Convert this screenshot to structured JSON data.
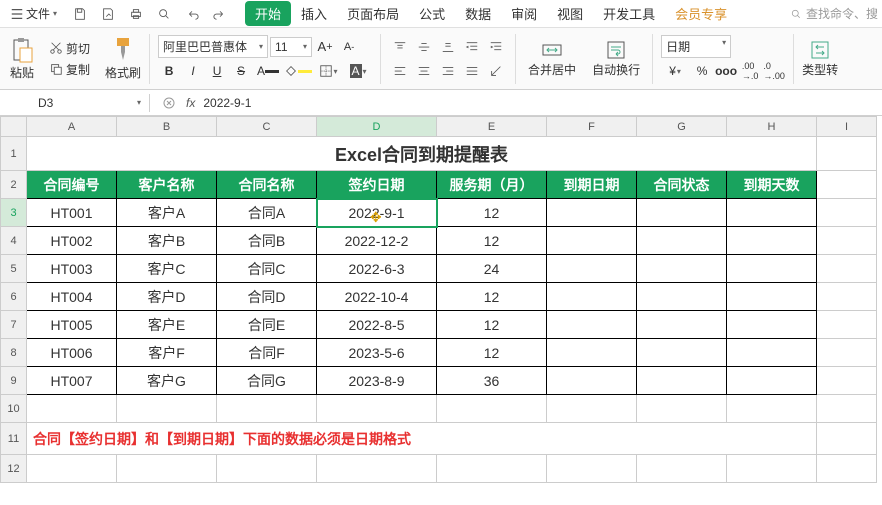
{
  "menu": {
    "file": "文件",
    "dd": "▾"
  },
  "tabs": {
    "start": "开始",
    "insert": "插入",
    "layout": "页面布局",
    "formula": "公式",
    "data": "数据",
    "review": "审阅",
    "view": "视图",
    "dev": "开发工具",
    "vip": "会员专享"
  },
  "search_ph": "查找命令、搜",
  "ribbon": {
    "paste": "粘贴",
    "cut": "剪切",
    "copy": "复制",
    "fmtpaint": "格式刷",
    "font": "阿里巴巴普惠体",
    "size": "11",
    "merge": "合并居中",
    "wrap": "自动换行",
    "numfmt": "日期",
    "typefmt": "类型转"
  },
  "namebox": "D3",
  "formula": "2022-9-1",
  "cols": [
    "A",
    "B",
    "C",
    "D",
    "E",
    "F",
    "G",
    "H",
    "I"
  ],
  "title": "Excel合同到期提醒表",
  "headers": [
    "合同编号",
    "客户名称",
    "合同名称",
    "签约日期",
    "服务期（月）",
    "到期日期",
    "合同状态",
    "到期天数"
  ],
  "rows": [
    {
      "n": "3",
      "d": [
        "HT001",
        "客户A",
        "合同A",
        "2022-9-1",
        "12",
        "",
        "",
        ""
      ]
    },
    {
      "n": "4",
      "d": [
        "HT002",
        "客户B",
        "合同B",
        "2022-12-2",
        "12",
        "",
        "",
        ""
      ]
    },
    {
      "n": "5",
      "d": [
        "HT003",
        "客户C",
        "合同C",
        "2022-6-3",
        "24",
        "",
        "",
        ""
      ]
    },
    {
      "n": "6",
      "d": [
        "HT004",
        "客户D",
        "合同D",
        "2022-10-4",
        "12",
        "",
        "",
        ""
      ]
    },
    {
      "n": "7",
      "d": [
        "HT005",
        "客户E",
        "合同E",
        "2022-8-5",
        "12",
        "",
        "",
        ""
      ]
    },
    {
      "n": "8",
      "d": [
        "HT006",
        "客户F",
        "合同F",
        "2023-5-6",
        "12",
        "",
        "",
        ""
      ]
    },
    {
      "n": "9",
      "d": [
        "HT007",
        "客户G",
        "合同G",
        "2023-8-9",
        "36",
        "",
        "",
        ""
      ]
    }
  ],
  "note": "合同【签约日期】和【到期日期】下面的数据必须是日期格式",
  "chart_data": {
    "type": "table",
    "title": "Excel合同到期提醒表",
    "columns": [
      "合同编号",
      "客户名称",
      "合同名称",
      "签约日期",
      "服务期（月）",
      "到期日期",
      "合同状态",
      "到期天数"
    ],
    "data": [
      [
        "HT001",
        "客户A",
        "合同A",
        "2022-9-1",
        12,
        null,
        null,
        null
      ],
      [
        "HT002",
        "客户B",
        "合同B",
        "2022-12-2",
        12,
        null,
        null,
        null
      ],
      [
        "HT003",
        "客户C",
        "合同C",
        "2022-6-3",
        24,
        null,
        null,
        null
      ],
      [
        "HT004",
        "客户D",
        "合同D",
        "2022-10-4",
        12,
        null,
        null,
        null
      ],
      [
        "HT005",
        "客户E",
        "合同E",
        "2022-8-5",
        12,
        null,
        null,
        null
      ],
      [
        "HT006",
        "客户F",
        "合同F",
        "2023-5-6",
        12,
        null,
        null,
        null
      ],
      [
        "HT007",
        "客户G",
        "合同G",
        "2023-8-9",
        36,
        null,
        null,
        null
      ]
    ]
  }
}
